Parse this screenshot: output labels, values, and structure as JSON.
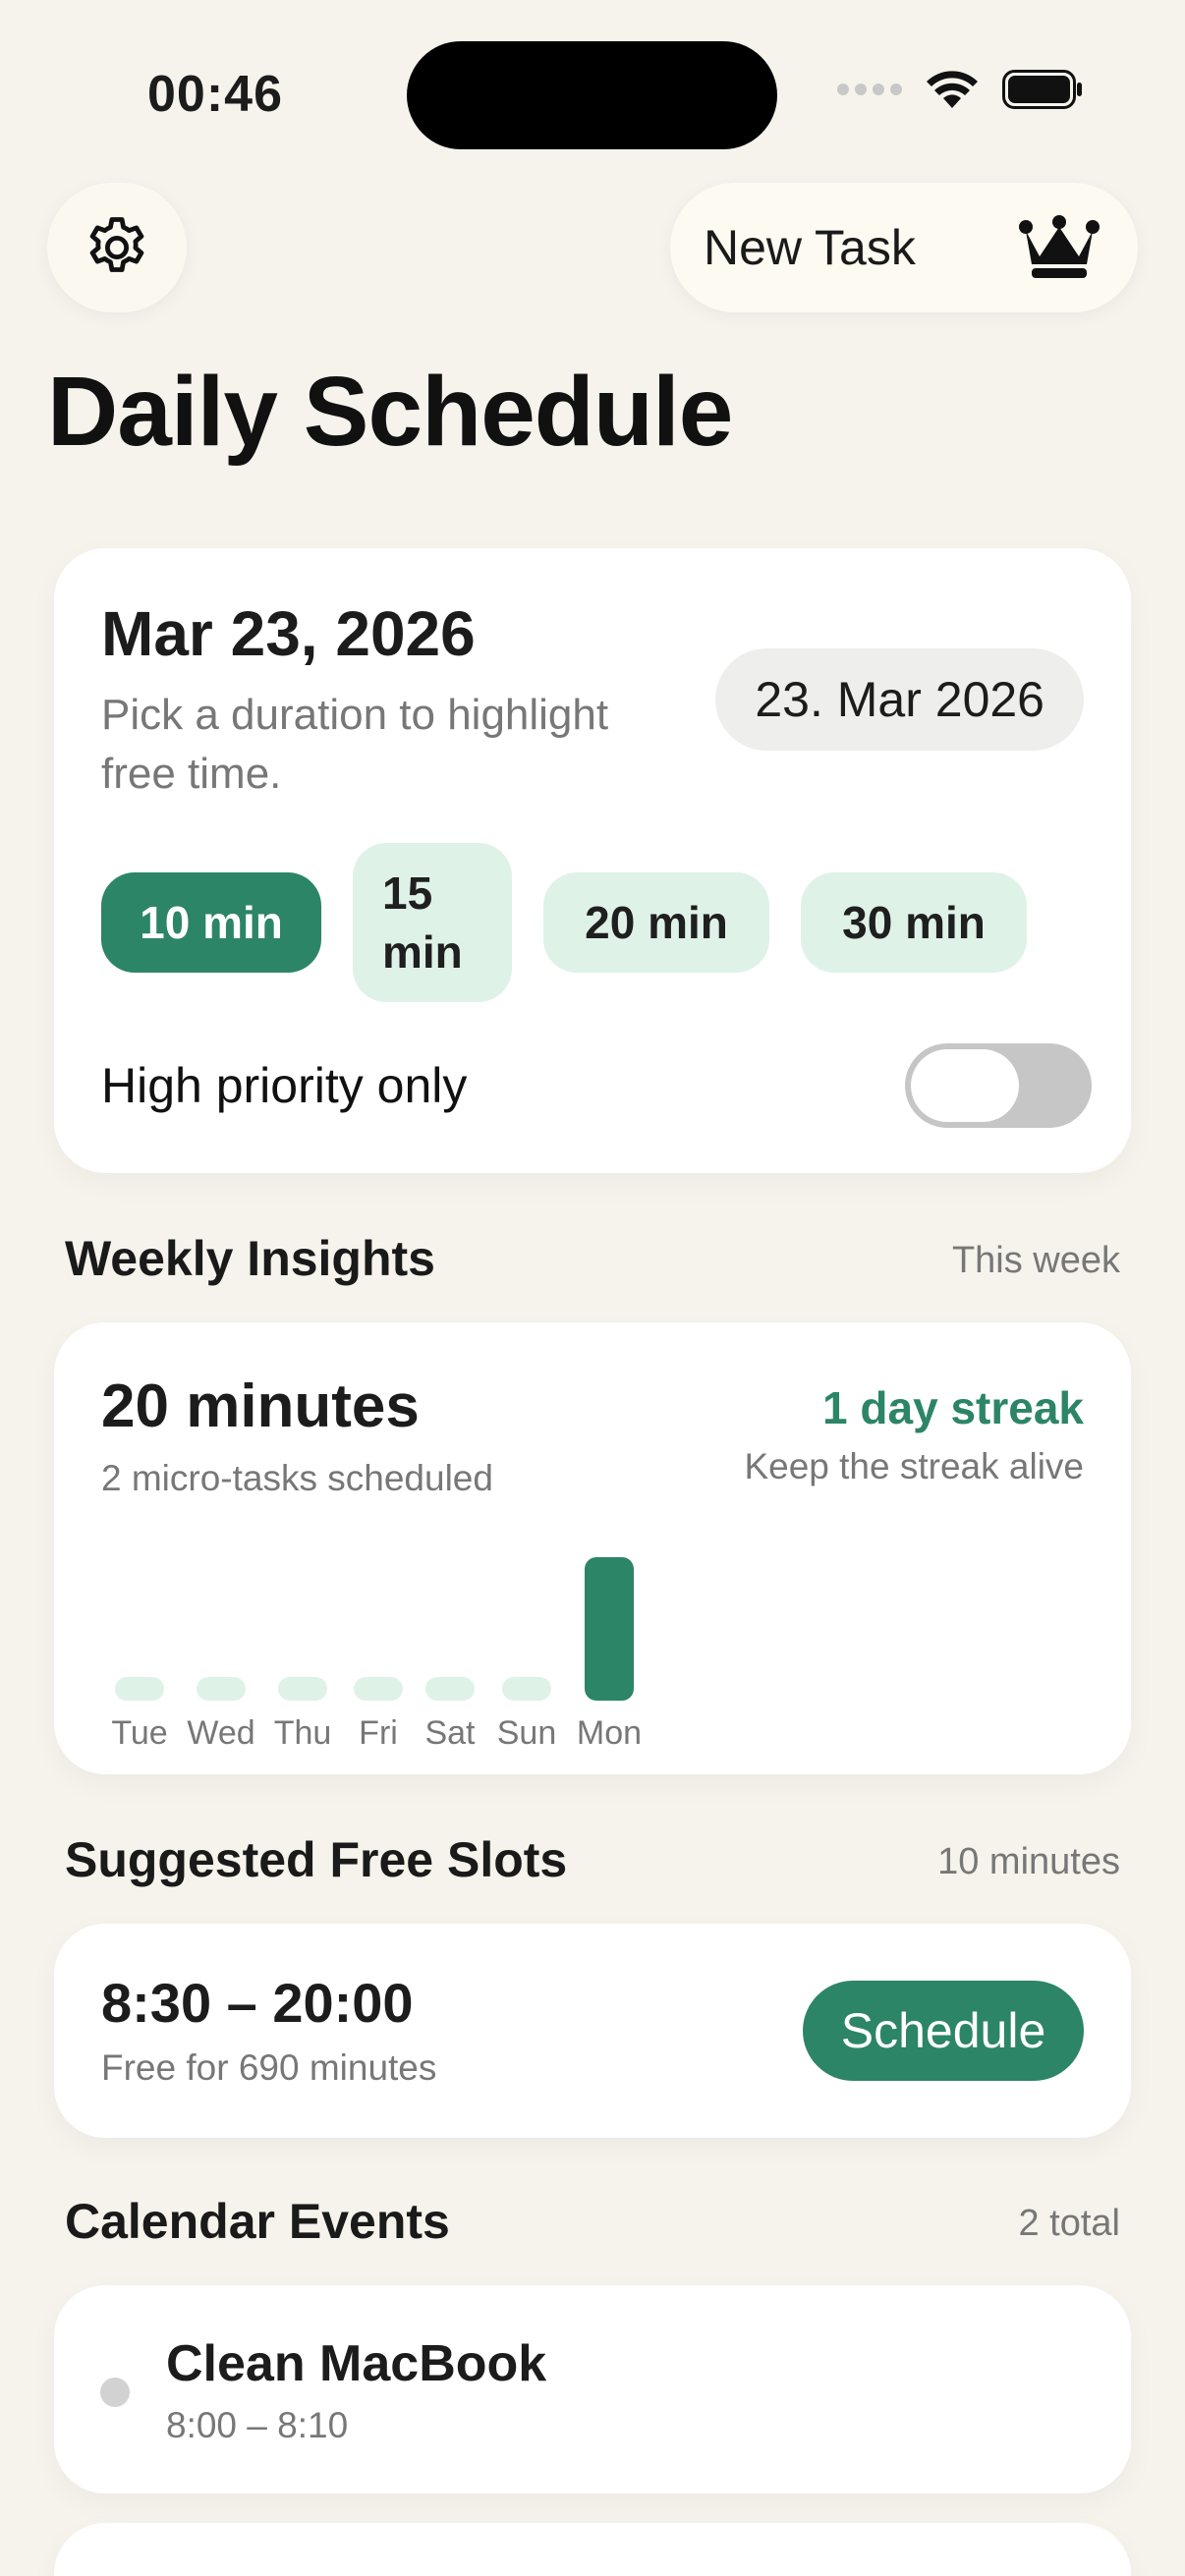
{
  "status_bar": {
    "time": "00:46"
  },
  "header": {
    "settings_icon": "gear-icon",
    "new_task_label": "New Task",
    "premium_icon": "crown-icon",
    "title": "Daily Schedule"
  },
  "date_card": {
    "date_title": "Mar 23, 2026",
    "subtitle": "Pick a duration to highlight free time.",
    "date_pill": "23. Mar 2026",
    "durations": [
      {
        "label": "10 min",
        "selected": true
      },
      {
        "label": "15 min",
        "selected": false
      },
      {
        "label": "20 min",
        "selected": false
      },
      {
        "label": "30 min",
        "selected": false
      }
    ],
    "priority_label": "High priority only",
    "priority_on": false
  },
  "insights": {
    "section_title": "Weekly Insights",
    "section_meta": "This week",
    "total": "20 minutes",
    "subtitle": "2 micro-tasks scheduled",
    "streak": "1 day streak",
    "streak_sub": "Keep the streak alive",
    "accent_color": "#2c8566",
    "empty_bar_color": "#dff2e8"
  },
  "chart_data": {
    "type": "bar",
    "categories": [
      "Tue",
      "Wed",
      "Thu",
      "Fri",
      "Sat",
      "Sun",
      "Mon"
    ],
    "values": [
      0,
      0,
      0,
      0,
      0,
      0,
      20
    ],
    "ylabel": "",
    "xlabel": ""
  },
  "slots": {
    "section_title": "Suggested Free Slots",
    "section_meta": "10 minutes",
    "time_range": "8:30 – 20:00",
    "subtitle": "Free for 690 minutes",
    "button": "Schedule"
  },
  "events": {
    "section_title": "Calendar Events",
    "section_meta": "2 total",
    "items": [
      {
        "title": "Clean MacBook",
        "time": "8:00 – 8:10"
      }
    ]
  }
}
